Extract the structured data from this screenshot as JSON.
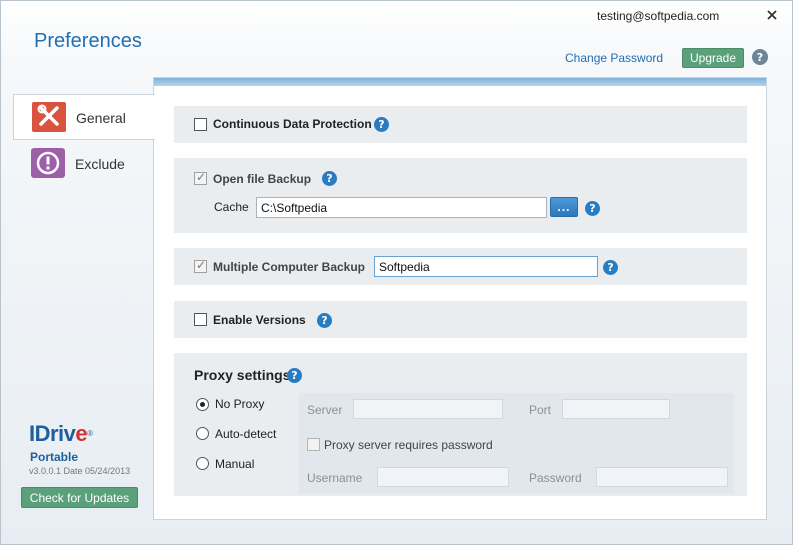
{
  "header": {
    "email": "testing@softpedia.com",
    "title": "Preferences",
    "change_password": "Change Password",
    "upgrade": "Upgrade",
    "help": "?"
  },
  "tabs": [
    {
      "label": "General",
      "icon": "tools-icon",
      "selected": true
    },
    {
      "label": "Exclude",
      "icon": "warning-icon",
      "selected": false
    }
  ],
  "general": {
    "continuous_protection": {
      "label": "Continuous Data Protection",
      "checked": false
    },
    "open_file_backup": {
      "label": "Open file Backup",
      "checked": true
    },
    "cache": {
      "label": "Cache",
      "value": "C:\\Softpedia",
      "browse": "..."
    },
    "multiple_computer": {
      "label": "Multiple Computer Backup",
      "checked": true,
      "value": "Softpedia"
    },
    "enable_versions": {
      "label": "Enable Versions",
      "checked": false
    },
    "proxy": {
      "title": "Proxy settings",
      "options": [
        "No Proxy",
        "Auto-detect",
        "Manual"
      ],
      "selected": "No Proxy",
      "server_label": "Server",
      "server_value": "",
      "port_label": "Port",
      "port_value": "",
      "requires_password": "Proxy server requires password",
      "username_label": "Username",
      "username_value": "",
      "password_label": "Password",
      "password_value": ""
    }
  },
  "footer": {
    "logo_main": "IDriv",
    "logo_e": "e",
    "logo_reg": "®",
    "portable": "Portable",
    "version": "v3.0.0.1 Date 05/24/2013",
    "check_updates": "Check for Updates"
  },
  "colors": {
    "accent_blue": "#1f6fb5",
    "upgrade_green": "#5aa07a",
    "general_icon": "#d9533f",
    "exclude_icon": "#9c5fa8"
  }
}
